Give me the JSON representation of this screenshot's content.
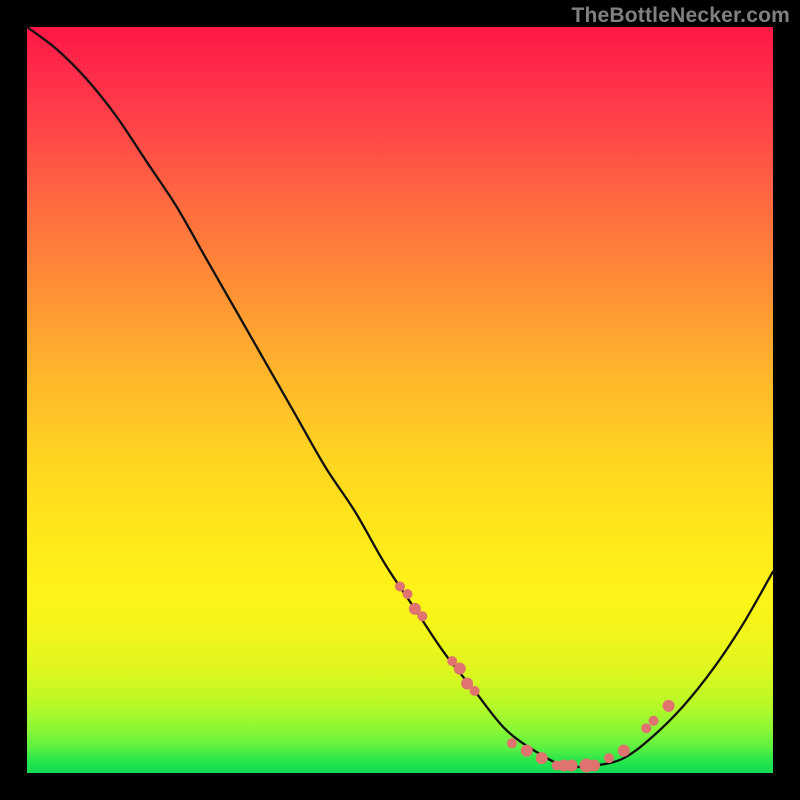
{
  "watermark": "TheBottleNecker.com",
  "colors": {
    "background": "#000000",
    "watermark": "#808080",
    "marker": "#e0736f",
    "curve": "#111111"
  },
  "chart_data": {
    "type": "line",
    "title": "",
    "xlabel": "",
    "ylabel": "",
    "xlim": [
      0,
      100
    ],
    "ylim": [
      0,
      100
    ],
    "series": [
      {
        "name": "bottleneck-curve",
        "x": [
          0,
          4,
          8,
          12,
          16,
          20,
          24,
          28,
          32,
          36,
          40,
          44,
          48,
          52,
          56,
          60,
          64,
          68,
          72,
          76,
          80,
          84,
          88,
          92,
          96,
          100
        ],
        "y": [
          100,
          97,
          93,
          88,
          82,
          76,
          69,
          62,
          55,
          48,
          41,
          35,
          28,
          22,
          16,
          11,
          6,
          3,
          1,
          1,
          2,
          5,
          9,
          14,
          20,
          27
        ]
      }
    ],
    "markers": {
      "name": "highlight-points",
      "x": [
        50,
        51,
        52,
        53,
        57,
        58,
        59,
        60,
        65,
        67,
        69,
        71,
        72,
        73,
        75,
        76,
        78,
        80,
        83,
        84,
        86
      ],
      "y": [
        25,
        24,
        22,
        21,
        15,
        14,
        12,
        11,
        4,
        3,
        2,
        1,
        1,
        1,
        1,
        1,
        2,
        3,
        6,
        7,
        9
      ],
      "r": [
        5,
        5,
        6,
        5,
        5,
        6,
        6,
        5,
        5,
        6,
        6,
        5,
        6,
        6,
        7,
        6,
        5,
        6,
        5,
        5,
        6
      ]
    }
  }
}
